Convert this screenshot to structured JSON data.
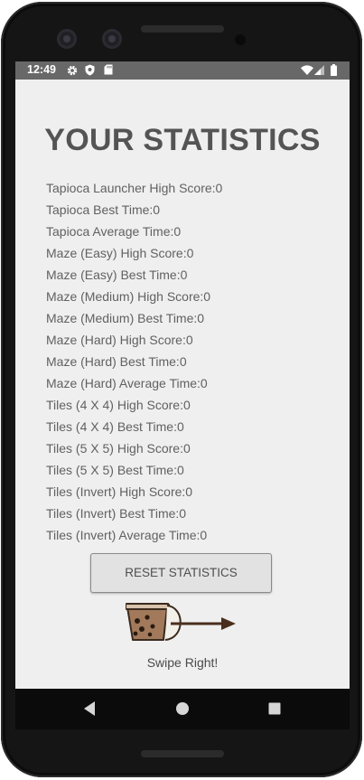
{
  "status_bar": {
    "time": "12:49",
    "icons": [
      "gear-icon",
      "shield-icon",
      "sd-card-icon",
      "wifi-icon",
      "signal-icon",
      "battery-icon"
    ]
  },
  "page": {
    "title": "YOUR STATISTICS",
    "stats": [
      "Tapioca Launcher High Score:0",
      "Tapioca Best Time:0",
      "Tapioca Average Time:0",
      "Maze (Easy) High Score:0",
      "Maze (Easy) Best Time:0",
      "Maze (Medium) High Score:0",
      "Maze (Medium) Best Time:0",
      "Maze (Hard) High Score:0",
      "Maze (Hard) Best Time:0",
      "Maze (Hard) Average Time:0",
      "Tiles (4 X 4) High Score:0",
      "Tiles (4 X 4) Best Time:0",
      "Tiles (5 X 5) High Score:0",
      "Tiles (5 X 5) Best Time:0",
      "Tiles (Invert) High Score:0",
      "Tiles (Invert) Best Time:0",
      "Tiles (Invert) Average Time:0"
    ],
    "reset_button": "RESET STATISTICS",
    "swipe_hint": "Swipe Right!"
  },
  "nav_bar": {
    "icons": [
      "back-icon",
      "home-icon",
      "recents-icon"
    ]
  },
  "colors": {
    "screen_bg": "#efefef",
    "status_bar_bg": "#686868",
    "title_text": "#545454",
    "stat_text": "#616161",
    "nav_bar_bg": "#0b0b0b",
    "boba_cup_fill": "#a27a5b",
    "arrow": "#4a2e1d"
  }
}
